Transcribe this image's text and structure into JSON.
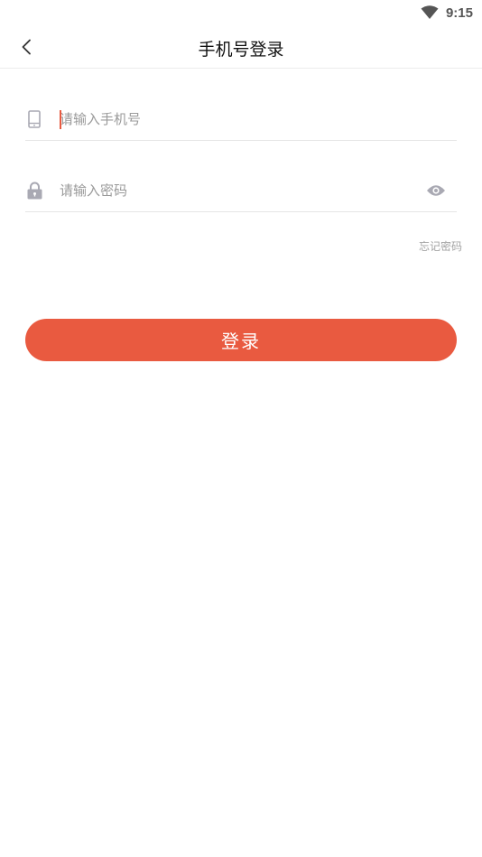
{
  "status_bar": {
    "time": "9:15",
    "wifi_icon": "wifi-icon"
  },
  "header": {
    "title": "手机号登录",
    "back_icon": "chevron-left-icon"
  },
  "form": {
    "phone": {
      "placeholder": "请输入手机号",
      "value": "",
      "icon": "phone-icon"
    },
    "password": {
      "placeholder": "请输入密码",
      "value": "",
      "icon": "lock-icon",
      "toggle_icon": "eye-icon"
    },
    "forgot_password_label": "忘记密码",
    "submit_label": "登录"
  },
  "colors": {
    "accent": "#e95a40",
    "icon_gray": "#a9a9b3",
    "placeholder": "#9a9a9a",
    "divider": "#e6e6e6"
  }
}
